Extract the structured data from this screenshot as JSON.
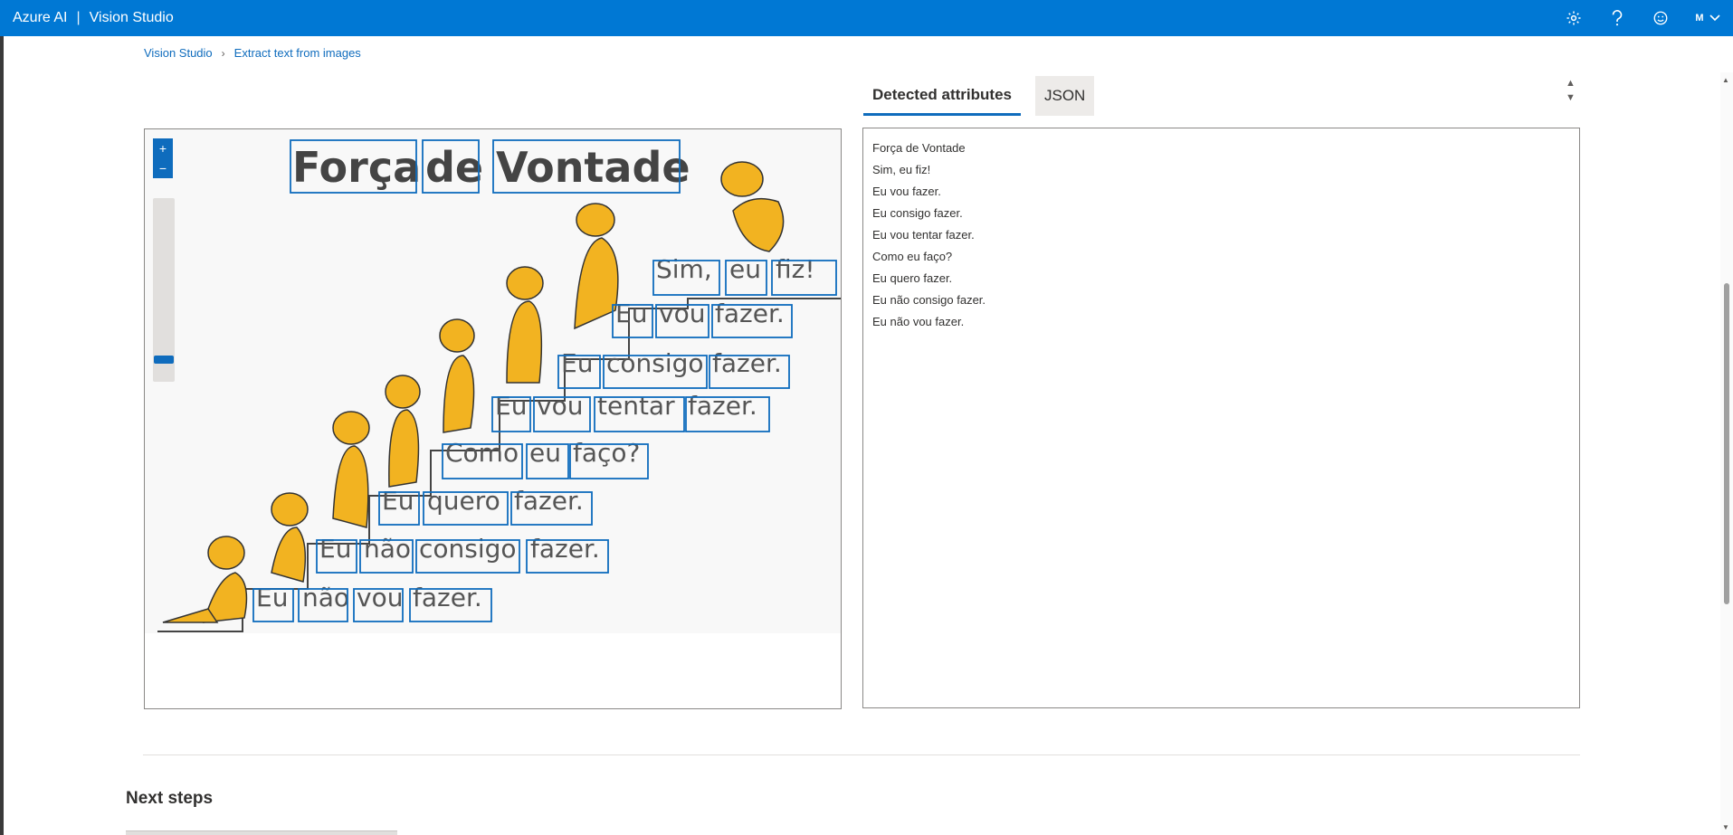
{
  "header": {
    "brand": "Azure AI",
    "separator": "|",
    "product": "Vision Studio",
    "avatar_initial": "M",
    "icons": [
      "gear-icon",
      "help-icon",
      "smiley-icon",
      "chevron-down-icon"
    ]
  },
  "breadcrumb": {
    "root": "Vision Studio",
    "current": "Extract text from images"
  },
  "tabs": {
    "detected": "Detected attributes",
    "json": "JSON"
  },
  "image": {
    "words": [
      [
        "Força",
        "de",
        "Vontade"
      ],
      [
        "Sim,",
        "eu",
        "fiz!"
      ],
      [
        "Eu",
        "vou",
        "fazer."
      ],
      [
        "Eu",
        "consigo",
        "fazer."
      ],
      [
        "Eu",
        "vou",
        "tentar",
        "fazer."
      ],
      [
        "Como",
        "eu",
        "faço?"
      ],
      [
        "Eu",
        "quero",
        "fazer."
      ],
      [
        "Eu",
        "não",
        "consigo",
        "fazer."
      ],
      [
        "Eu",
        "não",
        "vou",
        "fazer."
      ]
    ],
    "zoom_in": "+",
    "zoom_out": "−"
  },
  "results": {
    "lines": [
      "Força de Vontade",
      "Sim, eu fiz!",
      "Eu vou fazer.",
      "Eu consigo fazer.",
      "Eu vou tentar fazer.",
      "Como eu faço?",
      "Eu quero fazer.",
      "Eu não consigo fazer.",
      "Eu não vou fazer."
    ]
  },
  "next_steps": {
    "title": "Next steps"
  },
  "colors": {
    "accent": "#0078d4",
    "bbox": "#0f6cbd",
    "figure": "#f2b321"
  }
}
